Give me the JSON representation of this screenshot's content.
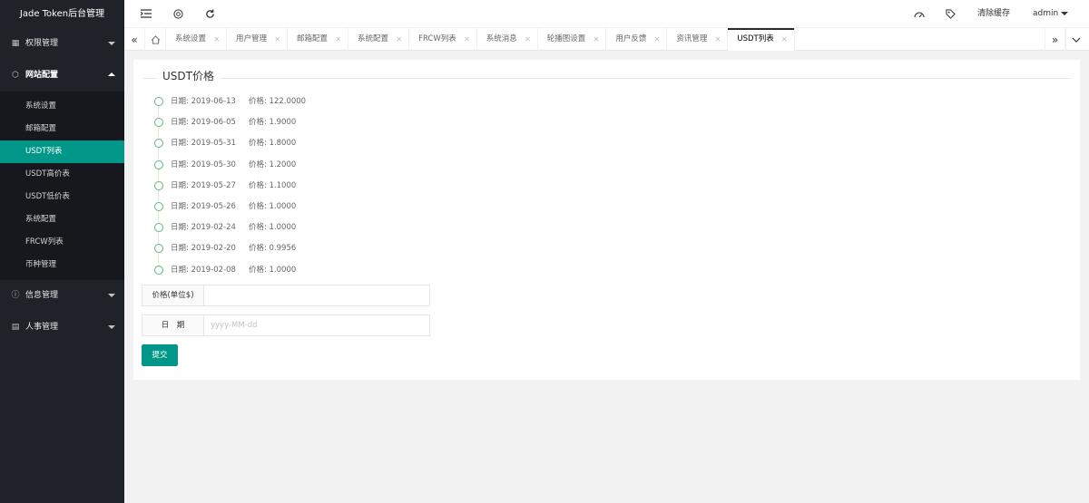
{
  "app": {
    "title": "Jade Token后台管理"
  },
  "sidebar": {
    "groups": [
      {
        "icon": "grid-icon",
        "label": "权限管理",
        "expanded": false
      },
      {
        "icon": "settings-icon",
        "label": "网站配置",
        "expanded": true,
        "items": [
          {
            "label": "系统设置"
          },
          {
            "label": "邮箱配置"
          },
          {
            "label": "USDT列表",
            "active": true
          },
          {
            "label": "USDT高价表"
          },
          {
            "label": "USDT低价表"
          },
          {
            "label": "系统配置"
          },
          {
            "label": "FRCW列表"
          },
          {
            "label": "币种管理"
          }
        ]
      },
      {
        "icon": "info-icon",
        "label": "信息管理",
        "expanded": false
      },
      {
        "icon": "document-icon",
        "label": "人事管理",
        "expanded": false
      }
    ]
  },
  "header": {
    "clear_cache": "清除缓存",
    "user": "admin"
  },
  "tabs": [
    {
      "label": "系统设置"
    },
    {
      "label": "用户管理"
    },
    {
      "label": "邮箱配置"
    },
    {
      "label": "系统配置"
    },
    {
      "label": "FRCW列表"
    },
    {
      "label": "系统消息"
    },
    {
      "label": "轮播图设置"
    },
    {
      "label": "用户反馈"
    },
    {
      "label": "资讯管理"
    },
    {
      "label": "USDT列表",
      "active": true
    }
  ],
  "main": {
    "title": "USDT价格",
    "timeline": [
      {
        "date": "日期: 2019-06-13",
        "price": "价格: 122.0000"
      },
      {
        "date": "日期: 2019-06-05",
        "price": "价格: 1.9000"
      },
      {
        "date": "日期: 2019-05-31",
        "price": "价格: 1.8000"
      },
      {
        "date": "日期: 2019-05-30",
        "price": "价格: 1.2000"
      },
      {
        "date": "日期: 2019-05-27",
        "price": "价格: 1.1000"
      },
      {
        "date": "日期: 2019-05-26",
        "price": "价格: 1.0000"
      },
      {
        "date": "日期: 2019-02-24",
        "price": "价格: 1.0000"
      },
      {
        "date": "日期: 2019-02-20",
        "price": "价格: 0.9956"
      },
      {
        "date": "日期: 2019-02-08",
        "price": "价格: 1.0000"
      }
    ],
    "form": {
      "price_label": "价格(单位$)",
      "price_value": "",
      "date_label": "日　期",
      "date_placeholder": "yyyy-MM-dd",
      "submit_label": "提交"
    }
  },
  "colors": {
    "accent": "#009688",
    "sidebar_bg": "#20222a",
    "timeline_dot": "#5fb878"
  }
}
